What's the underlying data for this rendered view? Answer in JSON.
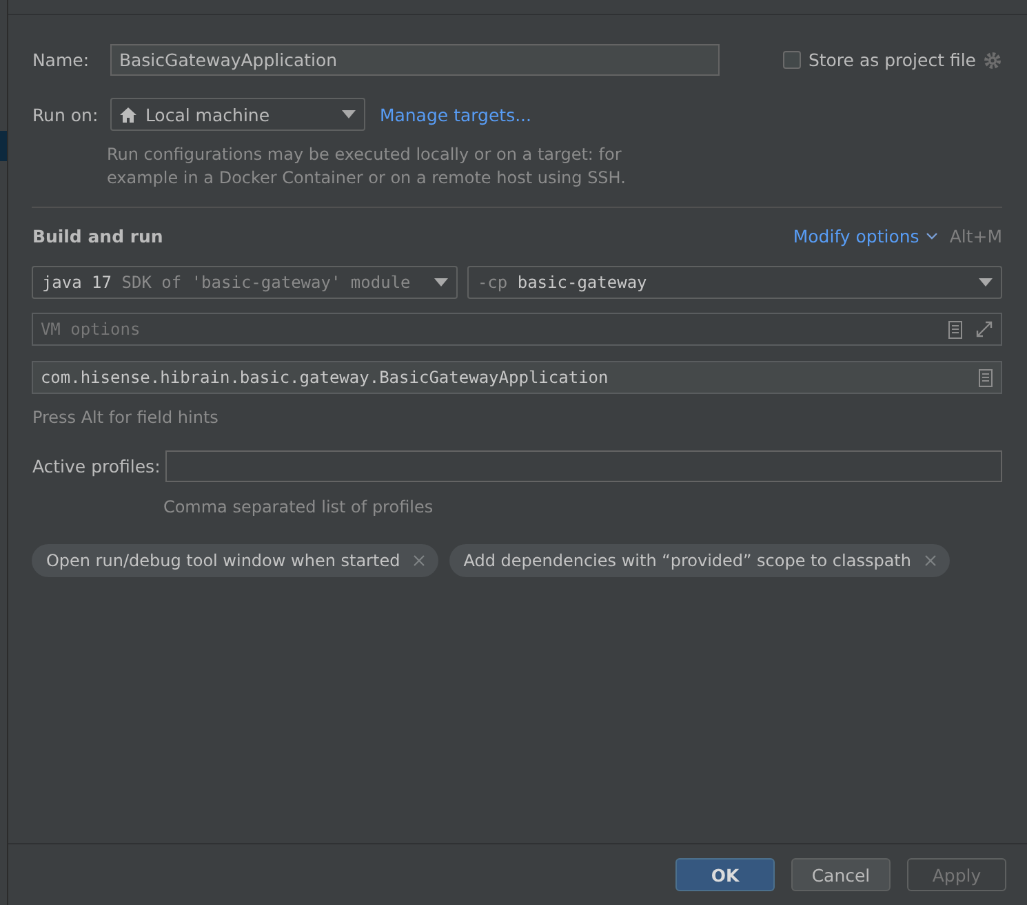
{
  "name": {
    "label": "Name:",
    "value": "BasicGatewayApplication"
  },
  "store_as_project_file": {
    "label": "Store as project file",
    "checked": false
  },
  "run_on": {
    "label": "Run on:",
    "value": "Local machine",
    "link": "Manage targets..."
  },
  "run_on_hint": "Run configurations may be executed locally or on a target: for example in a Docker Container or on a remote host using SSH.",
  "section": {
    "title": "Build and run",
    "modify_options": "Modify options",
    "shortcut": "Alt+M"
  },
  "jdk": {
    "version": "java 17",
    "description": "SDK of 'basic-gateway' module"
  },
  "classpath": {
    "prefix": "-cp",
    "value": "basic-gateway"
  },
  "vm_options": {
    "placeholder": "VM options"
  },
  "main_class": {
    "value": "com.hisense.hibrain.basic.gateway.BasicGatewayApplication"
  },
  "field_hint": "Press Alt for field hints",
  "active_profiles": {
    "label": "Active profiles:",
    "hint": "Comma separated list of profiles"
  },
  "chips": [
    {
      "label": "Open run/debug tool window when started"
    },
    {
      "label": "Add dependencies with “provided” scope to classpath"
    }
  ],
  "buttons": [
    {
      "label": "OK",
      "kind": "primary"
    },
    {
      "label": "Cancel",
      "kind": "default"
    },
    {
      "label": "Apply",
      "kind": "disabled"
    }
  ]
}
